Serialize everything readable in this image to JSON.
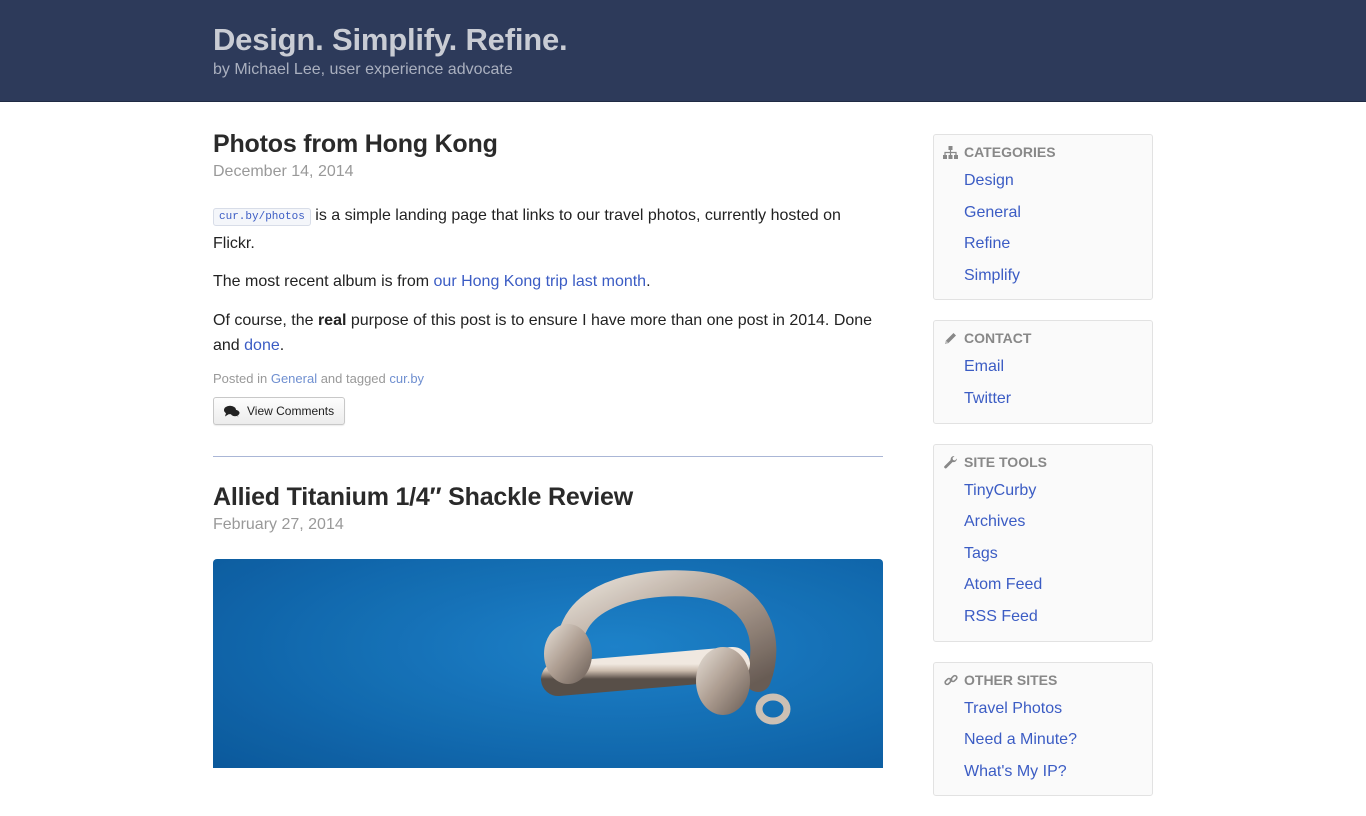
{
  "header": {
    "title": "Design. Simplify. Refine.",
    "subtitle": "by Michael Lee, user experience advocate"
  },
  "posts": [
    {
      "title": "Photos from Hong Kong",
      "date": "December 14, 2014",
      "p1_code": "cur.by/photos",
      "p1_text": " is a simple landing page that links to our travel photos, currently hosted on Flickr.",
      "p2_text": "The most recent album is from ",
      "p2_link": "our Hong Kong trip last month",
      "p2_end": ".",
      "p3_text1": "Of course, the ",
      "p3_bold": "real",
      "p3_text2": " purpose of this post is to ensure I have more than one post in 2014. Done and ",
      "p3_link": "done",
      "p3_end": ".",
      "meta_posted": "Posted in ",
      "meta_category": "General",
      "meta_tagged": " and tagged ",
      "meta_tag": "cur.by",
      "comments_label": "View Comments"
    },
    {
      "title": "Allied Titanium 1/4″ Shackle Review",
      "date": "February 27, 2014"
    }
  ],
  "sidebar": {
    "categories": {
      "title": "CATEGORIES",
      "icon": "sitemap-icon",
      "items": [
        "Design",
        "General",
        "Refine",
        "Simplify"
      ]
    },
    "contact": {
      "title": "CONTACT",
      "icon": "pencil-icon",
      "items": [
        "Email",
        "Twitter"
      ]
    },
    "site_tools": {
      "title": "SITE TOOLS",
      "icon": "wrench-icon",
      "items": [
        "TinyCurby",
        "Archives",
        "Tags",
        "Atom Feed",
        "RSS Feed"
      ]
    },
    "other_sites": {
      "title": "OTHER SITES",
      "icon": "link-icon",
      "items": [
        "Travel Photos",
        "Need a Minute?",
        "What's My IP?"
      ]
    }
  },
  "colors": {
    "header_bg": "#2d3a5a",
    "link": "#3b5cc4",
    "photo_bg": "#1a7fcc"
  }
}
